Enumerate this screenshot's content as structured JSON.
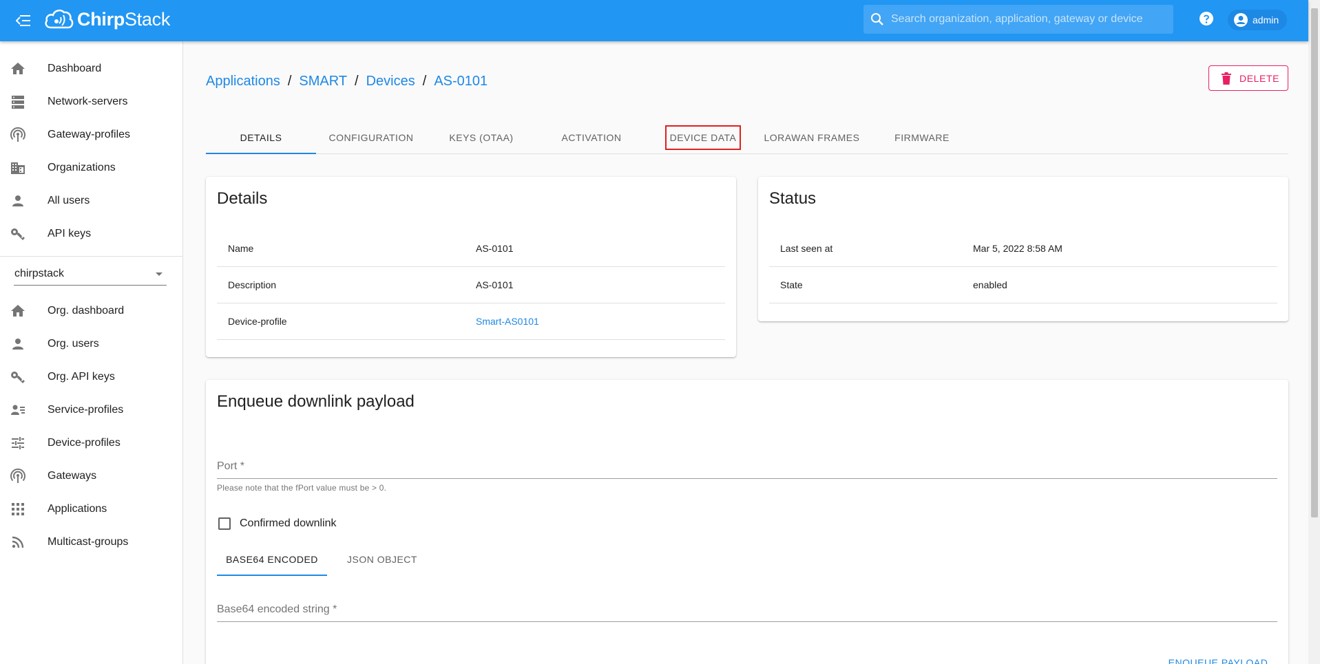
{
  "app": {
    "logo_bold": "Chirp",
    "logo_rest": "Stack"
  },
  "search": {
    "placeholder": "Search organization, application, gateway or device"
  },
  "user": {
    "name": "admin"
  },
  "sidebar": {
    "items": [
      {
        "label": "Dashboard",
        "icon": "home-icon"
      },
      {
        "label": "Network-servers",
        "icon": "server-icon"
      },
      {
        "label": "Gateway-profiles",
        "icon": "antenna-icon"
      },
      {
        "label": "Organizations",
        "icon": "building-icon"
      },
      {
        "label": "All users",
        "icon": "person-icon"
      },
      {
        "label": "API keys",
        "icon": "key-icon"
      }
    ],
    "org_select": "chirpstack",
    "org_items": [
      {
        "label": "Org. dashboard",
        "icon": "home-icon"
      },
      {
        "label": "Org. users",
        "icon": "person-icon"
      },
      {
        "label": "Org. API keys",
        "icon": "key-icon"
      },
      {
        "label": "Service-profiles",
        "icon": "account-details-icon"
      },
      {
        "label": "Device-profiles",
        "icon": "tune-icon"
      },
      {
        "label": "Gateways",
        "icon": "antenna-icon"
      },
      {
        "label": "Applications",
        "icon": "apps-icon"
      },
      {
        "label": "Multicast-groups",
        "icon": "rss-icon"
      }
    ]
  },
  "breadcrumb": {
    "items": [
      "Applications",
      "SMART",
      "Devices",
      "AS-0101"
    ],
    "separator": "/"
  },
  "delete_label": "DELETE",
  "tabs": [
    "DETAILS",
    "CONFIGURATION",
    "KEYS (OTAA)",
    "ACTIVATION",
    "DEVICE DATA",
    "LORAWAN FRAMES",
    "FIRMWARE"
  ],
  "active_tab": "DETAILS",
  "highlighted_tab": "DEVICE DATA",
  "details": {
    "title": "Details",
    "rows": [
      {
        "key": "Name",
        "value": "AS-0101"
      },
      {
        "key": "Description",
        "value": "AS-0101"
      },
      {
        "key": "Device-profile",
        "value": "Smart-AS0101"
      }
    ]
  },
  "status": {
    "title": "Status",
    "rows": [
      {
        "key": "Last seen at",
        "value": "Mar 5, 2022 8:58 AM"
      },
      {
        "key": "State",
        "value": "enabled"
      }
    ]
  },
  "downlink": {
    "title": "Enqueue downlink payload",
    "port_placeholder": "Port *",
    "port_help": "Please note that the fPort value must be > 0.",
    "confirmed_label": "Confirmed downlink",
    "subtabs": [
      "BASE64 ENCODED",
      "JSON OBJECT"
    ],
    "base64_placeholder": "Base64 encoded string *",
    "enqueue_label": "ENQUEUE PAYLOAD"
  },
  "colors": {
    "primary": "#2196f3",
    "accent": "#1e88e5",
    "danger": "#e91e63",
    "highlight": "#e02020"
  }
}
